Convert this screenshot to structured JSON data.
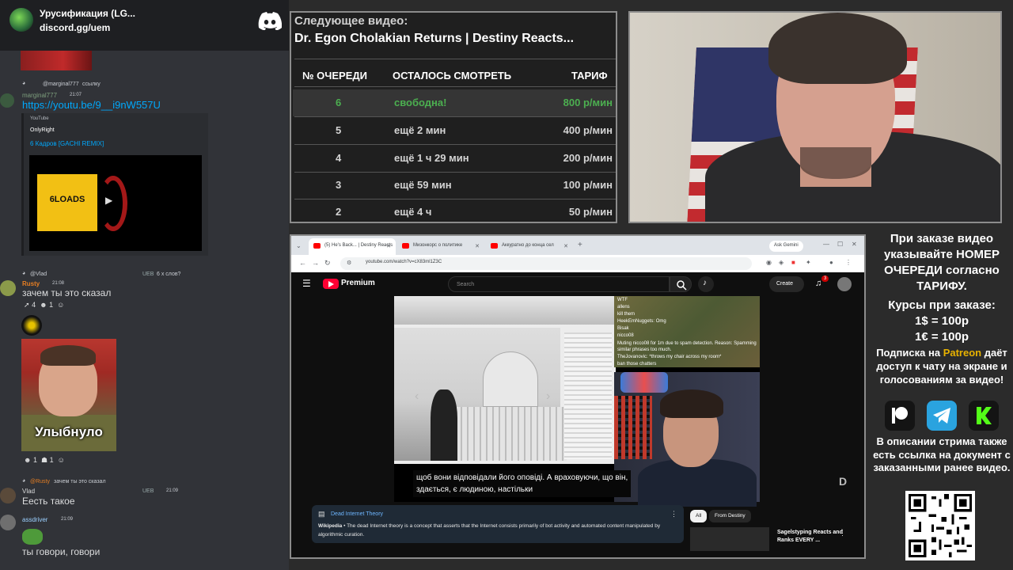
{
  "discord": {
    "server_name": "Урусификация (LG...",
    "server_link": "discord.gg/uem",
    "reply1_user": "@marginal777",
    "reply1_text": "ссылку",
    "msg1_user": "marginal777",
    "msg1_time": "21:07",
    "msg1_link": "https://youtu.be/9__i9nW557U",
    "embed": {
      "provider": "YouTube",
      "author": "OnlyRight",
      "title": "6 Кадров [GACHI REMIX]",
      "thumb_text": "6LOADS"
    },
    "reply2_user": "@Vlad",
    "reply2_text": "6 х слов?",
    "reply2_badge": "UEB",
    "msg2_user": "Rusty",
    "msg2_time": "21:08",
    "msg2_text": "зачем ты это сказал",
    "msg2_reactions": [
      "4",
      "1"
    ],
    "meme_caption": "Улыбнуло",
    "meme_reactions": [
      "1",
      "1"
    ],
    "reply3_user": "@Rusty",
    "reply3_text": "зачем ты это сказал",
    "msg3_user": "Vlad",
    "msg3_badge": "UEB",
    "msg3_time": "21:09",
    "msg3_text": "Еесть такое",
    "msg4_user": "assdriver",
    "msg4_time": "21:09",
    "msg4_text": "ты говори, говори"
  },
  "queue": {
    "next_label": "Следующее видео:",
    "next_title": "Dr. Egon Cholakian Returns | Destiny Reacts...",
    "headers": [
      "№ ОЧЕРЕДИ",
      "ОСТАЛОСЬ СМОТРЕТЬ",
      "ТАРИФ"
    ],
    "rows": [
      {
        "num": "6",
        "left": "свободна!",
        "rate": "800 р/мин"
      },
      {
        "num": "5",
        "left": "ещё 2 мин",
        "rate": "400 р/мин"
      },
      {
        "num": "4",
        "left": "ещё 1 ч 29 мин",
        "rate": "200 р/мин"
      },
      {
        "num": "3",
        "left": "ещё 59 мин",
        "rate": "100 р/мин"
      },
      {
        "num": "2",
        "left": "ещё 4 ч",
        "rate": "50 р/мин"
      }
    ]
  },
  "browser": {
    "tabs": [
      "(5) He's Back... | Destiny Reacts",
      "Мизонкорс о политике",
      "Аккуратно до конца сел"
    ],
    "ask_gemini": "Ask Gemini",
    "url": "youtube.com/watch?v=cX83ml1Z3C",
    "brand": "Premium",
    "search_placeholder": "Search",
    "create_label": "Create",
    "notif_count": "3",
    "subtitle_line1": "щоб вони відповідали його оповіді.  А враховуючи, що він,",
    "subtitle_line2": "здається, є людиною, настільки",
    "chat_lines": [
      "WTF",
      "allens",
      "kill them",
      "HeekEmNuggets: Omg",
      "Bisak",
      "nicco08",
      "Muting nicco08 for 1m due to spam detection. Reason: Spamming similar phrases too much.",
      "TheJovanovic: *throws my chair across my room*",
      "ban those chatters"
    ],
    "infobox_title": "Dead Internet Theory",
    "infobox_source": "Wikipedia",
    "infobox_text": "The dead Internet theory is a concept that asserts that the Internet consists primarily of bot activity and automated content manipulated by algorithmic curation.",
    "chip_all": "All",
    "chip_from": "From Destiny",
    "side_video_title": "Sagelstyping Reacts and Ranks EVERY ..."
  },
  "info": {
    "order_text": "При заказе видео указывайте НОМЕР ОЧЕРЕДИ согласно ТАРИФУ.",
    "rates_text": "Курсы при заказе: 1$ = 100р 1€ = 100р",
    "rates_title": "Курсы при заказе:",
    "rate_usd": "1$ = 100р",
    "rate_eur": "1€ = 100р",
    "sub_pre": "Подписка на",
    "sub_patreon": "Patreon",
    "sub_post": "даёт доступ к чату на экране и голосованиям за видео!",
    "desc_text": "В описании стрима также есть ссылка на документ с заказанными ранее видео.",
    "colors": {
      "patreon": "#e8b200",
      "telegram": "#2aa3df",
      "kick": "#53fc18"
    }
  }
}
